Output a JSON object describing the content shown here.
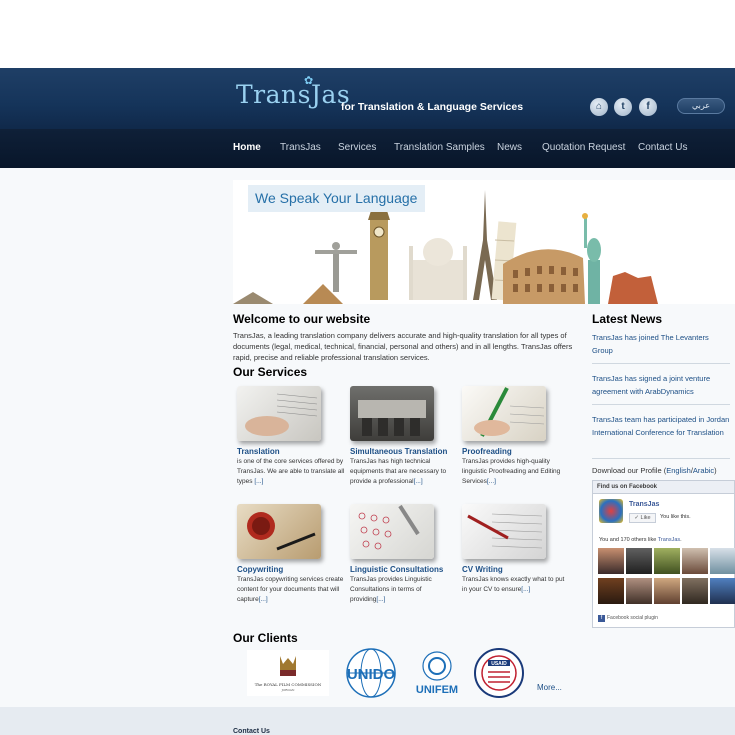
{
  "header": {
    "logo_text": "TransJas",
    "tagline": "for Translation & Language Services",
    "arabic_label": "عربي"
  },
  "nav": {
    "items": [
      {
        "label": "Home",
        "active": true
      },
      {
        "label": "TransJas"
      },
      {
        "label": "Services"
      },
      {
        "label": "Translation Samples"
      },
      {
        "label": "News"
      },
      {
        "label": "Quotation Request"
      },
      {
        "label": "Contact Us"
      }
    ]
  },
  "banner": {
    "headline": "We Speak Your Language"
  },
  "welcome": {
    "title": "Welcome to our website",
    "text": "TransJas, a leading translation company delivers accurate and high-quality translation for all types of documents (legal, medical, technical, financial, personal and others) and in all lengths. TransJas offers rapid, precise and reliable professional translation services."
  },
  "services": {
    "title": "Our Services",
    "items": [
      {
        "title": "Translation",
        "text": "is one of the core services offered by TransJas. We are able to translate all types",
        "more": "[...]"
      },
      {
        "title": "Simultaneous Translation",
        "text": "TransJas has high technical equipments that are necessary to provide a professional",
        "more": "[...]"
      },
      {
        "title": "Proofreading",
        "text": "TransJas provides high-quality linguistic Proofreading and Editing Services",
        "more": "[...]"
      },
      {
        "title": "Copywriting",
        "text": "TransJas copywriting services create content for your documents that will capture",
        "more": "[...]"
      },
      {
        "title": "Linguistic Consultations",
        "text": "TransJas provides Linguistic Consultations in terms of providing",
        "more": "[...]"
      },
      {
        "title": "CV Writing",
        "text": "TransJas knows exactly what to put in your CV to ensure",
        "more": "[...]"
      }
    ]
  },
  "clients": {
    "title": "Our Clients",
    "logos": [
      {
        "name": "The Royal Film Commission Jordan"
      },
      {
        "name": "UNIDO"
      },
      {
        "name": "UNIFEM"
      },
      {
        "name": "USAID"
      }
    ],
    "more_label": "More..."
  },
  "news": {
    "title": "Latest News",
    "items": [
      "TransJas has joined The Levanters Group",
      "TransJas has signed a joint venture agreement with ArabDynamics",
      "TransJas team has participated in Jordan International Conference for Translation"
    ]
  },
  "profile": {
    "prefix": "Download our Profile (",
    "english": "English",
    "separator": "/",
    "arabic": "Arabic",
    "suffix": ")"
  },
  "facebook": {
    "header": "Find us on Facebook",
    "page_name": "TransJas",
    "like_label": "Like",
    "you_like": "You like this.",
    "others_prefix": "You and 170 others like ",
    "others_page": "TransJas",
    "others_suffix": ".",
    "plugin_label": "Facebook social plugin"
  },
  "footer": {
    "title": "Contact Us"
  }
}
